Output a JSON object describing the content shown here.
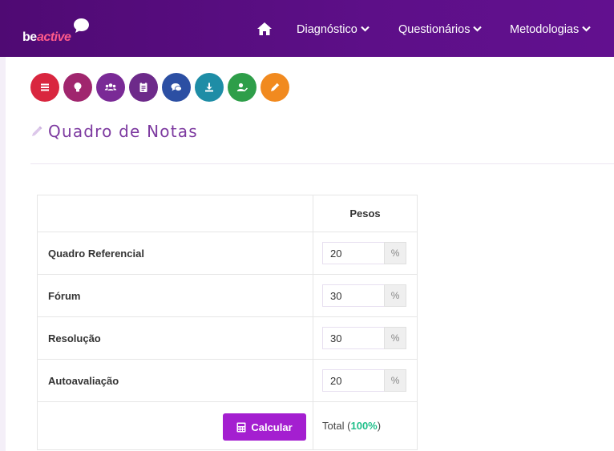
{
  "navbar": {
    "logo": {
      "part1": "be",
      "part2": "active"
    },
    "home_icon": "home-icon",
    "items": [
      {
        "label": "Diagnóstico",
        "icon": "chevron-down-icon"
      },
      {
        "label": "Questionários",
        "icon": "chevron-down-icon"
      },
      {
        "label": "Metodologias",
        "icon": "chevron-down-icon"
      }
    ],
    "color": "#5d0f88"
  },
  "toolbar": {
    "buttons": [
      {
        "icon": "menu-icon",
        "color": "#d9263f"
      },
      {
        "icon": "lightbulb-icon",
        "color": "#a0266e"
      },
      {
        "icon": "users-icon",
        "color": "#7a2a96"
      },
      {
        "icon": "clipboard-icon",
        "color": "#6d2a8a"
      },
      {
        "icon": "comments-icon",
        "color": "#2c4fa3"
      },
      {
        "icon": "download-icon",
        "color": "#1e8da6"
      },
      {
        "icon": "user-edit-icon",
        "color": "#2e9e49"
      },
      {
        "icon": "pencil-icon",
        "color": "#f18a1f"
      }
    ]
  },
  "page": {
    "title": "Quadro de Notas",
    "title_icon": "pencil-icon"
  },
  "table": {
    "header": {
      "name": "",
      "weights": "Pesos"
    },
    "rows": [
      {
        "name": "Quadro Referencial",
        "value": "20",
        "unit": "%"
      },
      {
        "name": "Fórum",
        "value": "30",
        "unit": "%"
      },
      {
        "name": "Resolução",
        "value": "30",
        "unit": "%"
      },
      {
        "name": "Autoavaliação",
        "value": "20",
        "unit": "%"
      }
    ],
    "calculate": {
      "label": "Calcular",
      "icon": "calculator-icon",
      "color": "#a41fd0"
    },
    "total": {
      "label": "Total",
      "open": "(",
      "value": "100%",
      "close": ")",
      "value_color": "#1fbf8a"
    }
  }
}
